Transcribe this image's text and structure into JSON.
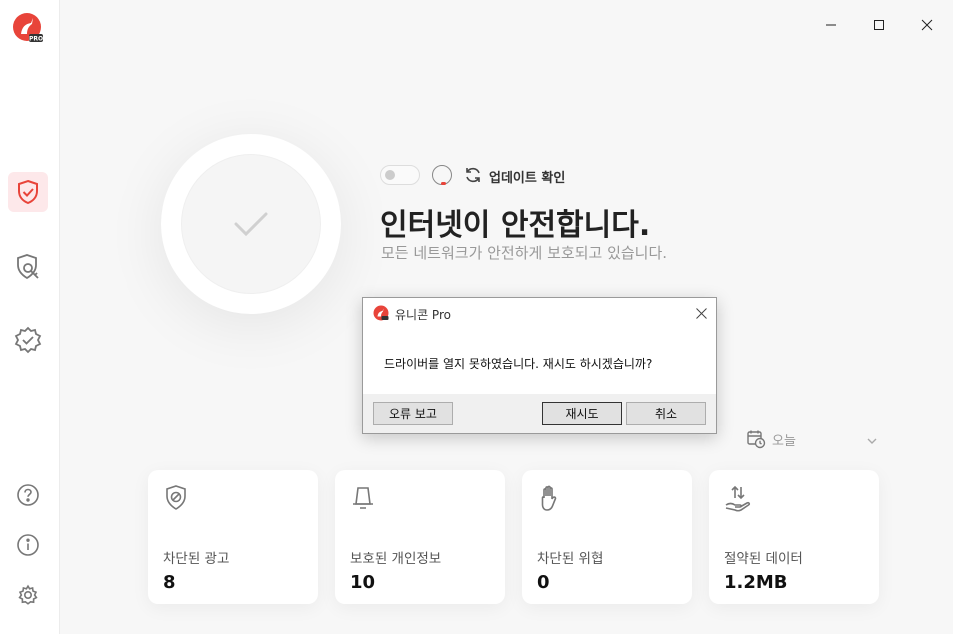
{
  "sidebar": {
    "logo_badge": "PRO",
    "items": [
      {
        "name": "protection",
        "icon": "shield-check-icon"
      },
      {
        "name": "privacy",
        "icon": "shield-key-icon"
      },
      {
        "name": "verified",
        "icon": "badge-check-icon"
      },
      {
        "name": "help",
        "icon": "question-icon"
      },
      {
        "name": "info",
        "icon": "info-icon"
      },
      {
        "name": "settings",
        "icon": "gear-icon"
      }
    ]
  },
  "status": {
    "update_label": "업데이트 확인",
    "headline": "인터넷이 안전합니다.",
    "subline": "모든 네트워크가 안전하게 보호되고 있습니다."
  },
  "date_filter": {
    "selected": "오늘"
  },
  "cards": [
    {
      "label": "차단된 광고",
      "value": "8",
      "icon": "ad-block-icon"
    },
    {
      "label": "보호된 개인정보",
      "value": "10",
      "icon": "bell-icon"
    },
    {
      "label": "차단된 위협",
      "value": "0",
      "icon": "hand-icon"
    },
    {
      "label": "절약된 데이터",
      "value": "1.2MB",
      "icon": "data-save-icon"
    }
  ],
  "dialog": {
    "title": "유니콘 Pro",
    "message": "드라이버를 열지 못하였습니다. 재시도 하시겠습니까?",
    "report_label": "오류 보고",
    "retry_label": "재시도",
    "cancel_label": "취소"
  },
  "colors": {
    "accent": "#e8443a",
    "active_bg": "#fde8ea"
  }
}
